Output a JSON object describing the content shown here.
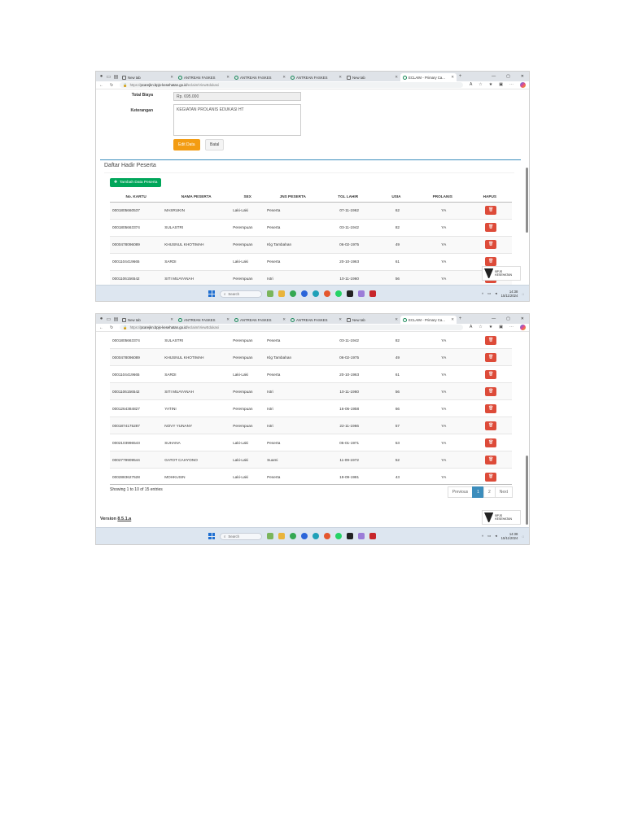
{
  "browser": {
    "tabs": [
      {
        "label": "New tab",
        "icon": "doc"
      },
      {
        "label": "ANTREAN FASKES",
        "icon": "globe"
      },
      {
        "label": "ANTREAN FASKES",
        "icon": "globe"
      },
      {
        "label": "ANTREAN FASKES",
        "icon": "globe"
      },
      {
        "label": "New tab",
        "icon": "doc"
      },
      {
        "label": "ECLAIM - Primary Ca...",
        "icon": "globe",
        "active": true
      }
    ],
    "url_prefix": "https://",
    "url_domain": "pcarejkn.bpjs-kesehatan.go.id",
    "url_path": "/eclaim/ViewEdukasi",
    "add_tab": "+",
    "win_controls": [
      "—",
      "▢",
      "✕"
    ]
  },
  "form": {
    "total_label": "Total Biaya",
    "total_value": "Rp. 695.000",
    "ket_label": "Keterangan",
    "ket_value": "KEGIATAN PROLANIS EDUKASI HT",
    "edit_button": "Edit Data",
    "batal_button": "Batal"
  },
  "panel": {
    "title": "Daftar Hadir Peserta",
    "add_button": "Tambah Data Peserta"
  },
  "table": {
    "headers": [
      "No. KARTU",
      "NAMA PESERTA",
      "SEX",
      "JNS PESERTA",
      "TGL LAHIR",
      "USIA",
      "PROLANIS",
      "HAPUS"
    ],
    "rows": [
      [
        "0001805660537",
        "MASRUKIN",
        "Laki-Laki",
        "Peserta",
        "07-11-1962",
        "62",
        "YA"
      ],
      [
        "0001805663374",
        "SULASTRI",
        "Perempuan",
        "Peserta",
        "03-11-1942",
        "82",
        "YA"
      ],
      [
        "0000478096089",
        "KHUSNUL KHOTIMAH",
        "Perempuan",
        "Klg Tambahan",
        "06-02-1975",
        "49",
        "YA"
      ],
      [
        "0001104419665",
        "SARDI",
        "Laki-Laki",
        "Peserta",
        "20-10-1963",
        "61",
        "YA"
      ],
      [
        "0001106156542",
        "SITI MUAYANAH",
        "Perempuan",
        "Istri",
        "10-11-1960",
        "56",
        "YA"
      ],
      [
        "0001264384827",
        "YATINI",
        "Perempuan",
        "Istri",
        "16-06-1958",
        "66",
        "YA"
      ],
      [
        "0001874175287",
        "NOVY YUNANY",
        "Perempuan",
        "Istri",
        "22-11-1966",
        "57",
        "YA"
      ],
      [
        "0002103996543",
        "SUHANA",
        "Laki-Laki",
        "Peserta",
        "05-01-1971",
        "53",
        "YA"
      ],
      [
        "0002779909544",
        "GATOT CAHYONO",
        "Laki-Laki",
        "Suami",
        "11-09-1972",
        "52",
        "YA"
      ],
      [
        "0002883627528",
        "MOHKUSIN",
        "Laki-Laki",
        "Peserta",
        "19-09-1981",
        "43",
        "YA"
      ]
    ],
    "delete_icon": "🗑"
  },
  "footer": {
    "showing": "Showing 1 to 10 of 15 entries",
    "pager": [
      "Previous",
      "1",
      "2",
      "Next"
    ],
    "version_label": "Version ",
    "version_value": "8.5.1.a"
  },
  "taskbar": {
    "search_placeholder": "Search",
    "time": "14:38",
    "date": "15/11/2024"
  },
  "watermark": {
    "text": "BPJS KESEHATAN"
  },
  "colors": {
    "primary": "#3c8dbc",
    "success": "#00a65a",
    "warning": "#f39c12",
    "danger": "#dd4b39"
  }
}
